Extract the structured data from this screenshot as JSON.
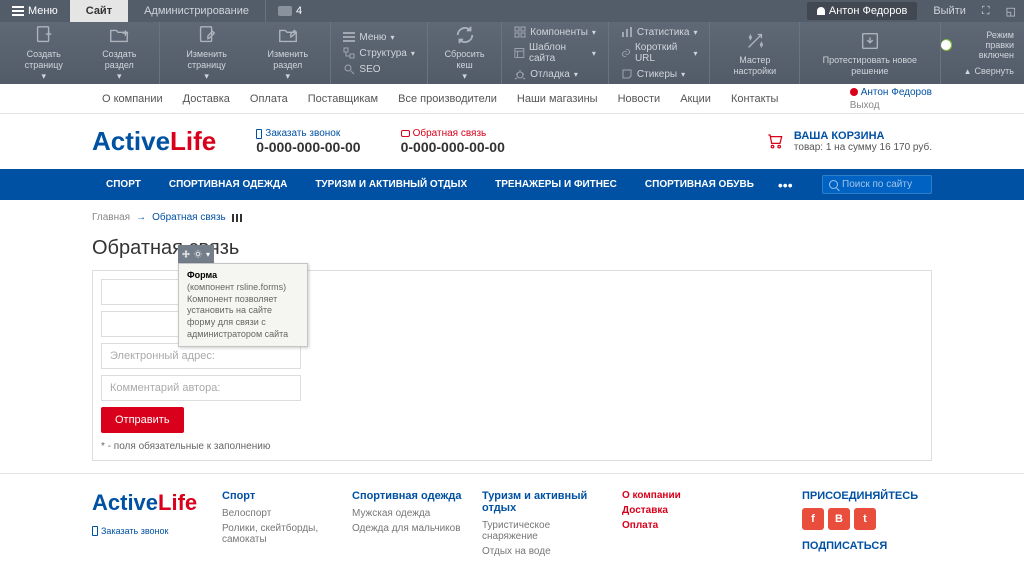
{
  "admin": {
    "menu": "Меню",
    "tab_site": "Сайт",
    "tab_admin": "Администрирование",
    "messages": "4",
    "user": "Антон Федоров",
    "logout": "Выйти",
    "toolbar": {
      "create_page": "Создать страницу",
      "create_section": "Создать раздел",
      "edit_page": "Изменить страницу",
      "edit_section": "Изменить раздел",
      "menu": "Меню",
      "structure": "Структура",
      "seo": "SEO",
      "reset_cache": "Сбросить кеш",
      "components": "Компоненты",
      "template": "Шаблон сайта",
      "debug": "Отладка",
      "statistics": "Статистика",
      "short_url": "Короткий URL",
      "stickers": "Стикеры",
      "wizard": "Мастер настройки",
      "test_solution": "Протестировать новое решение",
      "edit_mode": "Режим правки включен",
      "collapse": "Свернуть"
    }
  },
  "top_nav": [
    "О компании",
    "Доставка",
    "Оплата",
    "Поставщикам",
    "Все производители",
    "Наши магазины",
    "Новости",
    "Акции",
    "Контакты"
  ],
  "top_user": "Антон Федоров",
  "top_logout": "Выход",
  "header": {
    "logo_part1": "Active",
    "logo_part2": "Life",
    "callback_label": "Заказать звонок",
    "callback_phone": "0-000-000-00-00",
    "feedback_label": "Обратная связь",
    "feedback_phone": "0-000-000-00-00",
    "cart_title": "ВАША КОРЗИНА",
    "cart_summary": "товар: 1 на сумму 16 170 руб."
  },
  "main_nav": [
    "СПОРТ",
    "СПОРТИВНАЯ ОДЕЖДА",
    "ТУРИЗМ И АКТИВНЫЙ ОТДЫХ",
    "ТРЕНАЖЕРЫ И ФИТНЕС",
    "СПОРТИВНАЯ ОБУВЬ"
  ],
  "search_placeholder": "Поиск по сайту",
  "breadcrumb": {
    "home": "Главная",
    "current": "Обратная связь"
  },
  "page_title": "Обратная связь",
  "component_tip": {
    "title": "Форма",
    "subtitle": "(компонент rsline.forms)",
    "text": "Компонент позволяет установить на сайте форму для связи с администратором сайта"
  },
  "form": {
    "email_placeholder": "Электронный адрес:",
    "comment_placeholder": "Комментарий автора:",
    "submit": "Отправить",
    "note": "* - поля обязательные к заполнению"
  },
  "footer": {
    "callback": "Заказать звонок",
    "cols": [
      {
        "title": "Спорт",
        "links": [
          "Велоспорт",
          "Ролики, скейтборды, самокаты"
        ]
      },
      {
        "title": "Спортивная одежда",
        "links": [
          "Мужская одежда",
          "Одежда для мальчиков"
        ]
      },
      {
        "title": "Туризм и активный отдых",
        "links": [
          "Туристическое снаряжение",
          "Отдых на воде"
        ]
      },
      {
        "title_links": [
          "О компании",
          "Доставка",
          "Оплата"
        ]
      }
    ],
    "social_title": "ПРИСОЕДИНЯЙТЕСЬ",
    "subscribe_title": "ПОДПИСАТЬСЯ"
  }
}
